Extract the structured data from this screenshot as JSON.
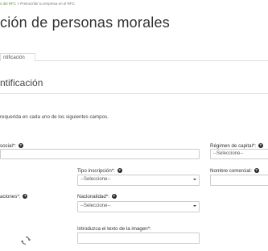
{
  "breadcrumb": {
    "link": "s del RFC",
    "separator": " > ",
    "current": "Preinscribir tu empresa en el RFC"
  },
  "page_title": "ción de personas morales",
  "tab": {
    "label": "ntificación"
  },
  "section_title": "ntificación",
  "instructions": "requerida en cada uno de los siguientes campos.",
  "fields": {
    "razon_social": {
      "label": "social*:"
    },
    "regimen_capital": {
      "label": "Régimen de capital*:",
      "value": "--Seleccione--"
    },
    "tipo_inscripcion": {
      "label": "Tipo inscripción*:",
      "value": "--Seleccione--"
    },
    "nombre_comercial": {
      "label": "Nombre comercial:"
    },
    "aplicaciones": {
      "label": "aciones*:"
    },
    "nacionalidad": {
      "label": "Nacionalidad*:",
      "value": "--Seleccione--"
    },
    "captcha": {
      "label": "Introduzca el texto de la imagen*:"
    }
  },
  "icons": {
    "help": "question-circle-icon",
    "reload": "refresh-icon"
  },
  "help_glyph": "?"
}
